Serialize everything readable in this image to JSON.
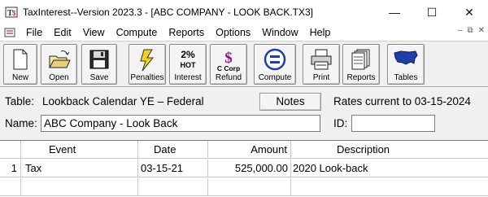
{
  "window": {
    "title": "TaxInterest--Version 2023.3 - [ABC COMPANY - LOOK BACK.TX3]",
    "minimize": "—",
    "maximize": "☐",
    "close": "✕"
  },
  "menu": {
    "items": [
      "File",
      "Edit",
      "View",
      "Compute",
      "Reports",
      "Options",
      "Window",
      "Help"
    ]
  },
  "toolbar": {
    "buttons": [
      {
        "label": "New",
        "icon": "new-document-icon"
      },
      {
        "label": "Open",
        "icon": "open-folder-icon"
      },
      {
        "label": "Save",
        "icon": "floppy-disk-icon"
      },
      {
        "label": "Penalties",
        "icon": "lightning-icon"
      },
      {
        "label": "Interest",
        "icon": "hot-interest-icon",
        "badge_top": "2%",
        "badge_mid": "HOT"
      },
      {
        "label": "Refund",
        "icon": "c-corp-refund-icon",
        "badge_mid": "C Corp"
      },
      {
        "label": "Compute",
        "icon": "compute-equals-icon"
      },
      {
        "label": "Print",
        "icon": "printer-icon"
      },
      {
        "label": "Reports",
        "icon": "reports-icon"
      },
      {
        "label": "Tables",
        "icon": "us-map-icon"
      }
    ]
  },
  "form": {
    "table_label": "Table:",
    "table_value": "Lookback Calendar YE – Federal Underpayment",
    "notes_label": "Notes",
    "rates_text": "Rates current to 03-15-2024",
    "name_label": "Name:",
    "name_value": "ABC Company - Look Back",
    "id_label": "ID:",
    "id_value": ""
  },
  "grid": {
    "headers": [
      "",
      "Event",
      "Date",
      "Amount",
      "Description"
    ],
    "rows": [
      [
        "1",
        "Tax",
        "03-15-21",
        "525,000.00",
        "2020 Look-back"
      ],
      [
        "",
        "",
        "",
        "",
        ""
      ]
    ]
  },
  "colors": {
    "background": "#f0f0f0",
    "accent_blue": "#1e3ea8",
    "penalty_yellow": "#f2d21b"
  }
}
